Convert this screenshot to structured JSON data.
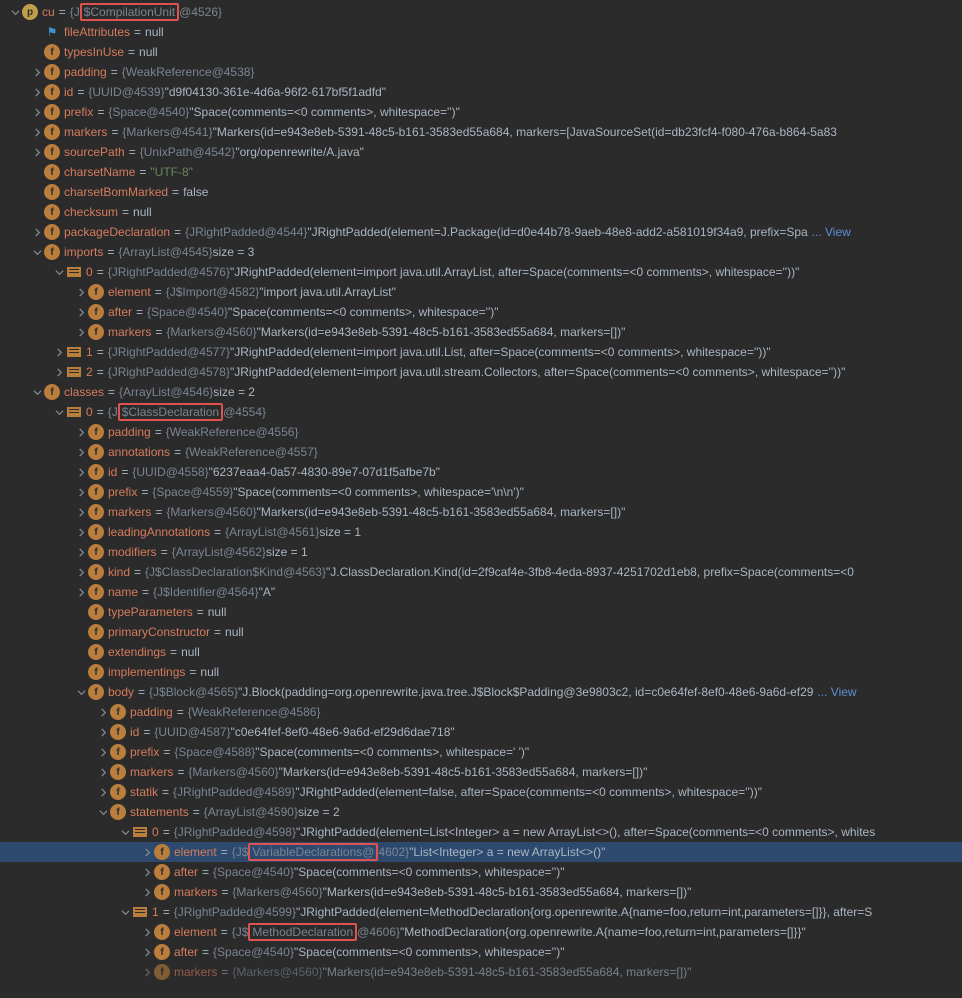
{
  "cu": {
    "name": "cu",
    "type_prefix": "{J",
    "type_hl": "$CompilationUnit",
    "type_suffix": "@4526}",
    "fileAttributes": {
      "name": "fileAttributes",
      "value": "null"
    },
    "typesInUse": {
      "name": "typesInUse",
      "value": "null"
    },
    "padding": {
      "name": "padding",
      "type": "{WeakReference@4538}"
    },
    "id": {
      "name": "id",
      "type": "{UUID@4539}",
      "value": "\"d9f04130-361e-4d6a-96f2-617bf5f1adfd\""
    },
    "prefix": {
      "name": "prefix",
      "type": "{Space@4540}",
      "value": "\"Space(comments=<0 comments>, whitespace='')\""
    },
    "markers": {
      "name": "markers",
      "type": "{Markers@4541}",
      "value": "\"Markers(id=e943e8eb-5391-48c5-b161-3583ed55a684, markers=[JavaSourceSet(id=db23fcf4-f080-476a-b864-5a83"
    },
    "sourcePath": {
      "name": "sourcePath",
      "type": "{UnixPath@4542}",
      "value": "\"org/openrewrite/A.java\""
    },
    "charsetName": {
      "name": "charsetName",
      "value": "\"UTF-8\""
    },
    "charsetBomMarked": {
      "name": "charsetBomMarked",
      "value": "false"
    },
    "checksum": {
      "name": "checksum",
      "value": "null"
    },
    "packageDeclaration": {
      "name": "packageDeclaration",
      "type": "{JRightPadded@4544}",
      "value": "\"JRightPadded(element=J.Package(id=d0e44b78-9aeb-48e8-add2-a581019f34a9, prefix=Spa",
      "view": "... View"
    },
    "imports": {
      "name": "imports",
      "type": "{ArrayList@4545}",
      "size": " size = 3",
      "items": [
        {
          "idx": "0",
          "type": "{JRightPadded@4576}",
          "value": "\"JRightPadded(element=import java.util.ArrayList, after=Space(comments=<0 comments>, whitespace=''))\"",
          "element": {
            "name": "element",
            "type": "{J$Import@4582}",
            "value": "\"import java.util.ArrayList\""
          },
          "after": {
            "name": "after",
            "type": "{Space@4540}",
            "value": "\"Space(comments=<0 comments>, whitespace='')\""
          },
          "markers": {
            "name": "markers",
            "type": "{Markers@4560}",
            "value": "\"Markers(id=e943e8eb-5391-48c5-b161-3583ed55a684, markers=[])\""
          }
        },
        {
          "idx": "1",
          "type": "{JRightPadded@4577}",
          "value": "\"JRightPadded(element=import java.util.List, after=Space(comments=<0 comments>, whitespace=''))\""
        },
        {
          "idx": "2",
          "type": "{JRightPadded@4578}",
          "value": "\"JRightPadded(element=import java.util.stream.Collectors, after=Space(comments=<0 comments>, whitespace=''))\""
        }
      ]
    },
    "classes": {
      "name": "classes",
      "type": "{ArrayList@4546}",
      "size": " size = 2",
      "item0": {
        "idx": "0",
        "type_prefix": "{J",
        "type_hl": "$ClassDeclaration",
        "type_suffix": "@4554}",
        "padding": {
          "name": "padding",
          "type": "{WeakReference@4556}"
        },
        "annotations": {
          "name": "annotations",
          "type": "{WeakReference@4557}"
        },
        "id": {
          "name": "id",
          "type": "{UUID@4558}",
          "value": "\"6237eaa4-0a57-4830-89e7-07d1f5afbe7b\""
        },
        "prefix": {
          "name": "prefix",
          "type": "{Space@4559}",
          "value": "\"Space(comments=<0 comments>, whitespace='\\n\\n')\""
        },
        "markers": {
          "name": "markers",
          "type": "{Markers@4560}",
          "value": "\"Markers(id=e943e8eb-5391-48c5-b161-3583ed55a684, markers=[])\""
        },
        "leadingAnnotations": {
          "name": "leadingAnnotations",
          "type": "{ArrayList@4561}",
          "size": " size = 1"
        },
        "modifiers": {
          "name": "modifiers",
          "type": "{ArrayList@4562}",
          "size": " size = 1"
        },
        "kind": {
          "name": "kind",
          "type": "{J$ClassDeclaration$Kind@4563}",
          "value": "\"J.ClassDeclaration.Kind(id=2f9caf4e-3fb8-4eda-8937-4251702d1eb8, prefix=Space(comments=<0"
        },
        "nameF": {
          "name": "name",
          "type": "{J$Identifier@4564}",
          "value": "\"A\""
        },
        "typeParameters": {
          "name": "typeParameters",
          "value": "null"
        },
        "primaryConstructor": {
          "name": "primaryConstructor",
          "value": "null"
        },
        "extendings": {
          "name": "extendings",
          "value": "null"
        },
        "implementings": {
          "name": "implementings",
          "value": "null"
        },
        "body": {
          "name": "body",
          "type": "{J$Block@4565}",
          "value": "\"J.Block(padding=org.openrewrite.java.tree.J$Block$Padding@3e9803c2, id=c0e64fef-8ef0-48e6-9a6d-ef29",
          "view": "... View",
          "padding": {
            "name": "padding",
            "type": "{WeakReference@4586}"
          },
          "id": {
            "name": "id",
            "type": "{UUID@4587}",
            "value": "\"c0e64fef-8ef0-48e6-9a6d-ef29d6dae718\""
          },
          "prefix": {
            "name": "prefix",
            "type": "{Space@4588}",
            "value": "\"Space(comments=<0 comments>, whitespace=' ')\""
          },
          "markers": {
            "name": "markers",
            "type": "{Markers@4560}",
            "value": "\"Markers(id=e943e8eb-5391-48c5-b161-3583ed55a684, markers=[])\""
          },
          "statik": {
            "name": "statik",
            "type": "{JRightPadded@4589}",
            "value": "\"JRightPadded(element=false, after=Space(comments=<0 comments>, whitespace=''))\""
          },
          "statements": {
            "name": "statements",
            "type": "{ArrayList@4590}",
            "size": " size = 2",
            "items": [
              {
                "idx": "0",
                "type": "{JRightPadded@4598}",
                "value": "\"JRightPadded(element=List<Integer> a = new ArrayList<>(), after=Space(comments=<0 comments>, whites",
                "element": {
                  "name": "element",
                  "type_prefix": "{J$",
                  "type_hl": "VariableDeclarations@",
                  "type_suffix": "4602}",
                  "value": "\"List<Integer> a = new ArrayList<>()\""
                },
                "after": {
                  "name": "after",
                  "type": "{Space@4540}",
                  "value": "\"Space(comments=<0 comments>, whitespace='')\""
                },
                "markers": {
                  "name": "markers",
                  "type": "{Markers@4560}",
                  "value": "\"Markers(id=e943e8eb-5391-48c5-b161-3583ed55a684, markers=[])\""
                }
              },
              {
                "idx": "1",
                "type": "{JRightPadded@4599}",
                "value": "\"JRightPadded(element=MethodDeclaration{org.openrewrite.A{name=foo,return=int,parameters=[]}}, after=S",
                "element": {
                  "name": "element",
                  "type_prefix": "{J$",
                  "type_hl": "MethodDeclaration",
                  "type_suffix": "@4606}",
                  "value": "\"MethodDeclaration{org.openrewrite.A{name=foo,return=int,parameters=[]}}\""
                },
                "after": {
                  "name": "after",
                  "type": "{Space@4540}",
                  "value": "\"Space(comments=<0 comments>, whitespace='')\""
                },
                "markers": {
                  "name": "markers",
                  "type": "{Markers@4560}",
                  "value": "\"Markers(id=e943e8eb-5391-48c5-b161-3583ed55a684, markers=[])\""
                }
              }
            ]
          }
        }
      }
    }
  }
}
